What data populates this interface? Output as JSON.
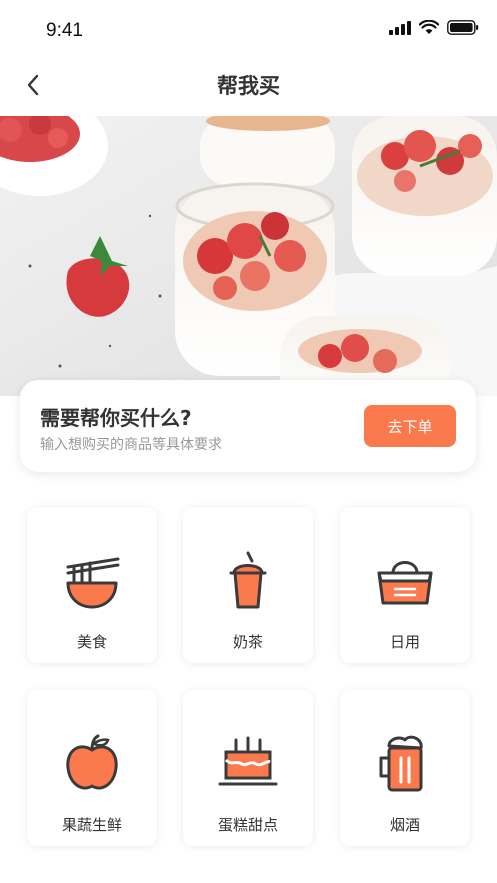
{
  "status": {
    "time": "9:41"
  },
  "nav": {
    "title": "帮我买"
  },
  "prompt": {
    "title": "需要帮你买什么?",
    "subtitle": "输入想购买的商品等具体要求",
    "order_button": "去下单"
  },
  "categories": [
    {
      "label": "美食",
      "icon": "noodle-bowl-icon"
    },
    {
      "label": "奶茶",
      "icon": "milk-tea-icon"
    },
    {
      "label": "日用",
      "icon": "basket-icon"
    },
    {
      "label": "果蔬生鲜",
      "icon": "apple-icon"
    },
    {
      "label": "蛋糕甜点",
      "icon": "cake-icon"
    },
    {
      "label": "烟酒",
      "icon": "beer-icon"
    }
  ],
  "colors": {
    "accent": "#fa7a4e",
    "icon_stroke": "#3a3a3a"
  }
}
